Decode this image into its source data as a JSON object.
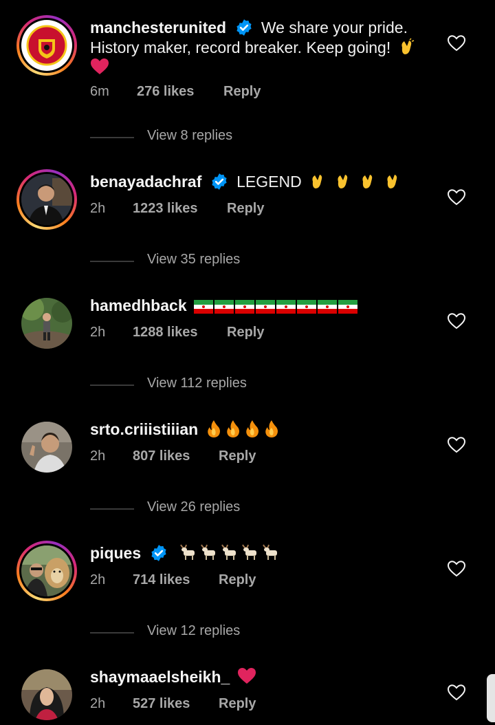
{
  "colors": {
    "background": "#000000",
    "username": "#f5f5f5",
    "meta": "#a8a8a8",
    "verified": "#0095f6",
    "heart_emoji": "#e0245e"
  },
  "comments": [
    {
      "username": "manchesterunited",
      "verified": true,
      "text_lines": [
        "We share your pride.",
        "History maker, record breaker. Keep going!"
      ],
      "emojis": [
        "clapping-hands",
        "red-heart"
      ],
      "time": "6m",
      "likes": "276 likes",
      "reply": "Reply",
      "view_replies": "View 8 replies",
      "avatar": "manchester-united-crest"
    },
    {
      "username": "benayadachraf",
      "verified": true,
      "text": "LEGEND",
      "emojis": [
        "clapping-hands",
        "clapping-hands",
        "clapping-hands",
        "clapping-hands"
      ],
      "time": "2h",
      "likes": "1223 likes",
      "reply": "Reply",
      "view_replies": "View 35 replies",
      "avatar": "man-in-suit-photo"
    },
    {
      "username": "hamedhback",
      "verified": false,
      "text": "",
      "emojis": [
        "iran-flag",
        "iran-flag",
        "iran-flag",
        "iran-flag",
        "iran-flag",
        "iran-flag",
        "iran-flag",
        "iran-flag"
      ],
      "time": "2h",
      "likes": "1288 likes",
      "reply": "Reply",
      "view_replies": "View 112 replies",
      "avatar": "person-outdoors-photo"
    },
    {
      "username": "srto.criiistiiian",
      "verified": false,
      "text": "",
      "emojis": [
        "fire",
        "fire",
        "fire",
        "fire"
      ],
      "time": "2h",
      "likes": "807 likes",
      "reply": "Reply",
      "view_replies": "View 26 replies",
      "avatar": "young-man-photo"
    },
    {
      "username": "piques",
      "verified": true,
      "text": "",
      "emojis": [
        "goat",
        "goat",
        "goat",
        "goat",
        "goat"
      ],
      "time": "2h",
      "likes": "714 likes",
      "reply": "Reply",
      "view_replies": "View 12 replies",
      "avatar": "man-with-lion-photo"
    },
    {
      "username": "shaymaaelsheikh_",
      "verified": false,
      "text": "",
      "emojis": [
        "red-heart"
      ],
      "time": "2h",
      "likes": "527 likes",
      "reply": "Reply",
      "avatar": "woman-in-hijab-photo"
    }
  ]
}
